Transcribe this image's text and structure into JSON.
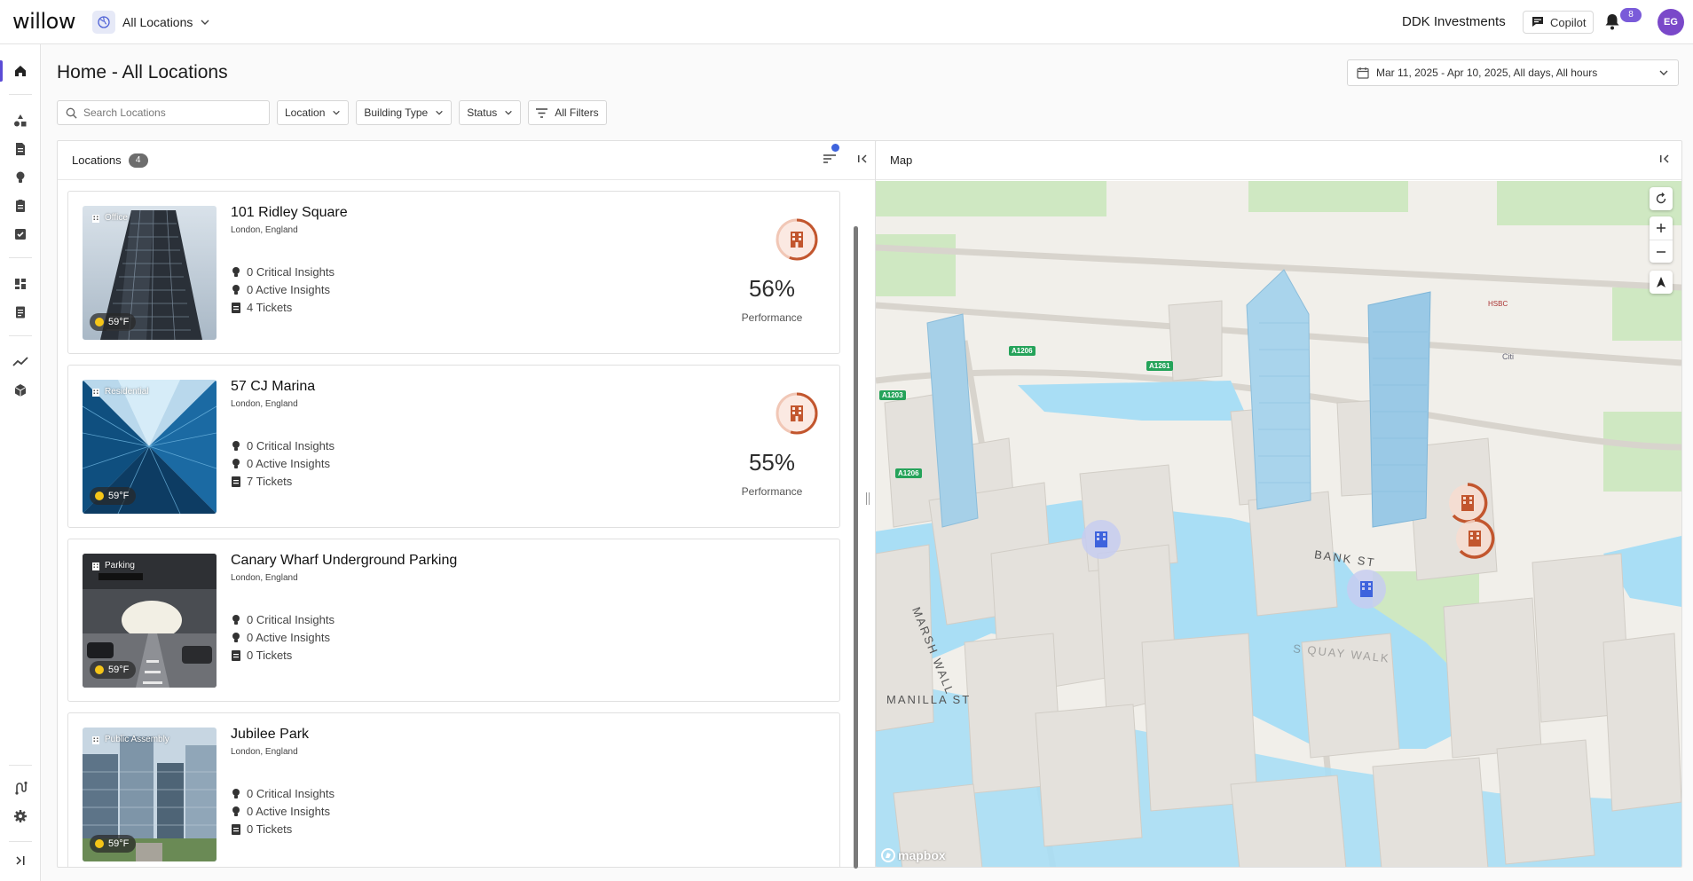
{
  "app": {
    "logo": "willow",
    "location_picker": "All Locations",
    "org": "DDK Investments",
    "copilot": "Copilot",
    "notifications": "8",
    "avatar": "EG"
  },
  "page": {
    "title": "Home - All Locations",
    "date_range": "Mar 11, 2025 - Apr 10, 2025, All days, All hours"
  },
  "filters": {
    "search_placeholder": "Search Locations",
    "location": "Location",
    "building_type": "Building Type",
    "status": "Status",
    "all_filters": "All Filters"
  },
  "locations_panel": {
    "title": "Locations",
    "count": "4"
  },
  "map_panel": {
    "title": "Map"
  },
  "locations": [
    {
      "name": "101 Ridley Square",
      "city": "London, England",
      "type": "Office",
      "temp": "59°F",
      "critical": "0 Critical Insights",
      "active": "0 Active Insights",
      "tickets": "4 Tickets",
      "performance": "56%",
      "performance_value": 0.56,
      "performance_label": "Performance"
    },
    {
      "name": "57 CJ Marina",
      "city": "London, England",
      "type": "Residential",
      "temp": "59°F",
      "critical": "0 Critical Insights",
      "active": "0 Active Insights",
      "tickets": "7 Tickets",
      "performance": "55%",
      "performance_value": 0.55,
      "performance_label": "Performance"
    },
    {
      "name": "Canary Wharf Underground Parking",
      "city": "London, England",
      "type": "Parking",
      "temp": "59°F",
      "critical": "0 Critical Insights",
      "active": "0 Active Insights",
      "tickets": "0 Tickets"
    },
    {
      "name": "Jubilee Park",
      "city": "London, England",
      "type": "Public Assembly",
      "temp": "59°F",
      "critical": "0 Critical Insights",
      "active": "0 Active Insights",
      "tickets": "0 Tickets"
    }
  ],
  "map": {
    "streets": [
      "MARSH WALL",
      "BANK ST",
      "MANILLA ST",
      "S QUAY WALK"
    ],
    "road_tags": [
      "A1206",
      "A1261",
      "A1203",
      "A1206"
    ],
    "building_labels": [
      "HSBC",
      "Citi"
    ],
    "attribution": "mapbox"
  },
  "colors": {
    "accent": "#5b4cd6",
    "performance_ring": "#c2562e",
    "marker_blue": "#3e63dd",
    "water": "#a9def5"
  }
}
